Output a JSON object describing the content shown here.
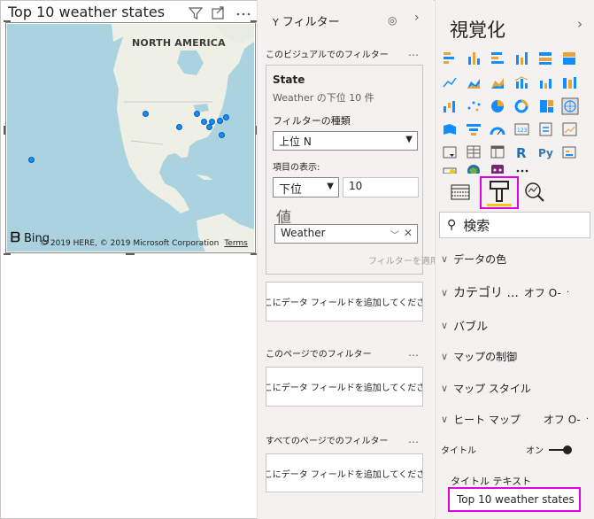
{
  "visual": {
    "title": "Top 10 weather states",
    "map": {
      "region_label": "NORTH AMERICA",
      "bing_label": "Bing",
      "copyright": "© 2019 HERE, © 2019 Microsoft Corporation",
      "terms": "Terms",
      "land_color": "#eef0e6",
      "water_color": "#aad3df",
      "point_color": "#118dff"
    }
  },
  "filters": {
    "header": "フィルター",
    "section_visual": "このビジュアルでのフィルター",
    "card": {
      "field": "State",
      "summary": "Weather の下位 10 件",
      "filter_type_label": "フィルターの種類",
      "filter_type_value": "上位 N",
      "show_items_label": "項目の表示:",
      "direction_value": "下位",
      "count_value": "10",
      "value_label": "値",
      "value_field": "Weather",
      "apply_button": "フィルターを適用"
    },
    "dropzone_visual": "ここにデータ フィールドを追加してください",
    "section_page": "このページでのフィルター",
    "dropzone_page": "ここにデータ フィールドを追加してください",
    "section_all": "すべてのページでのフィルター",
    "dropzone_all": "ここにデータ フィールドを追加してください"
  },
  "visualizations": {
    "title": "視覚化",
    "search_placeholder": "検索",
    "sections": {
      "data_colors": "データの色",
      "category_labels": "カテゴリ ...",
      "category_toggle": "オフ O-",
      "bubbles": "バブル",
      "map_controls": "マップの制御",
      "map_styles": "マップ スタイル",
      "heatmap": "ヒート マップ",
      "heatmap_toggle": "オフ O-",
      "title_toggle_label": "タイトル",
      "title_toggle_value": "オン",
      "title_text_label": "タイトル テキスト",
      "title_text_value": "Top 10 weather states"
    },
    "highlight_color": "#e000e0",
    "accent_color": "#f2c811"
  }
}
